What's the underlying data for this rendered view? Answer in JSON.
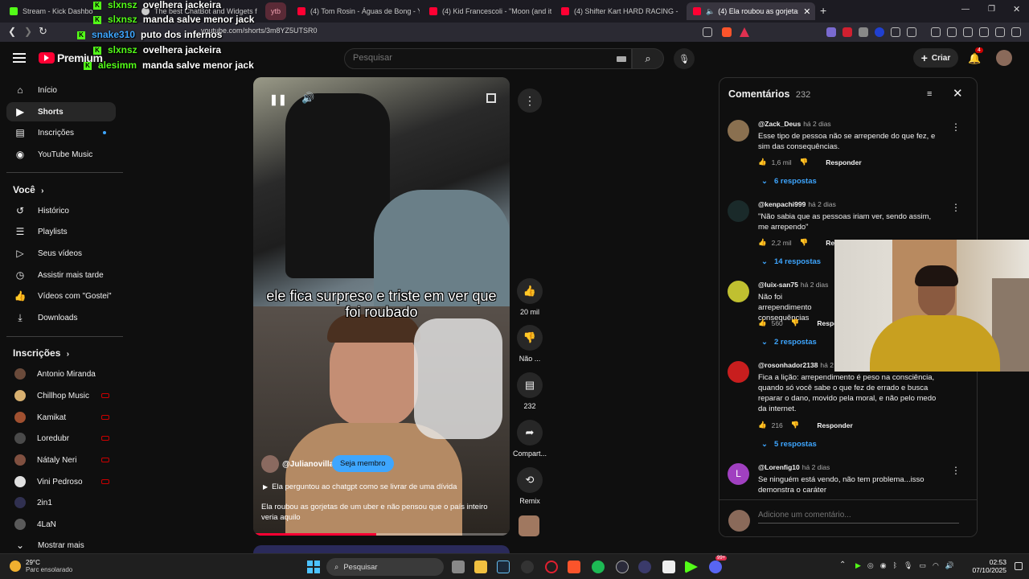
{
  "browser": {
    "tabs": [
      {
        "label": "Stream - Kick Dashboard",
        "color": "#53fc18"
      },
      {
        "label": "The best ChatBot and Widgets for Ki",
        "color": "#cccccc"
      },
      {
        "label": "ytb",
        "color": "#f0a0b0"
      },
      {
        "label": "(4) Tom Rosin - Águas de Bong - You",
        "color": "#ff0033"
      },
      {
        "label": "(4) Kid Francescoli - \"Moon (and it w",
        "color": "#ff0033"
      },
      {
        "label": "(4) Shifter Kart HARD RACING - POV",
        "color": "#ff0033"
      },
      {
        "label": "(4) Ela roubou as gorjetas de",
        "color": "#ff0033"
      }
    ],
    "new_tab": "+",
    "url": "youtube.com/shorts/3m8YZ5UTSR0"
  },
  "chat": [
    {
      "user": "slxnsz",
      "msg": "ovelhera jackeira",
      "blue": false
    },
    {
      "user": "slxnsz",
      "msg": "manda salve menor jack",
      "blue": false
    },
    {
      "user": "snake310",
      "msg": "puto dos infernos",
      "blue": true
    },
    {
      "user": "slxnsz",
      "msg": "ovelhera jackeira",
      "blue": false
    },
    {
      "user": "alesimm",
      "msg": "manda salve menor jack",
      "blue": false
    }
  ],
  "header": {
    "logo": "Premium",
    "search_placeholder": "Pesquisar",
    "create_label": "Criar",
    "notif_count": "4"
  },
  "sidebar": {
    "main": [
      {
        "label": "Início",
        "icon": "home-icon"
      },
      {
        "label": "Shorts",
        "icon": "shorts-icon"
      },
      {
        "label": "Inscrições",
        "icon": "subscriptions-icon"
      },
      {
        "label": "YouTube Music",
        "icon": "music-icon"
      }
    ],
    "voce_title": "Você",
    "voce": [
      {
        "label": "Histórico",
        "icon": "history-icon"
      },
      {
        "label": "Playlists",
        "icon": "playlist-icon"
      },
      {
        "label": "Seus vídeos",
        "icon": "video-icon"
      },
      {
        "label": "Assistir mais tarde",
        "icon": "clock-icon"
      },
      {
        "label": "Vídeos com \"Gostei\"",
        "icon": "like-icon"
      },
      {
        "label": "Downloads",
        "icon": "download-icon"
      }
    ],
    "subs_title": "Inscrições",
    "subs": [
      {
        "label": "Antonio Miranda",
        "color": "#6a4a3a",
        "live": false
      },
      {
        "label": "Chillhop Music",
        "color": "#d8b070",
        "live": true
      },
      {
        "label": "Kamikat",
        "color": "#a05030",
        "live": true
      },
      {
        "label": "Loredubr",
        "color": "#4a4a4a",
        "live": true
      },
      {
        "label": "Nátaly Neri",
        "color": "#805040",
        "live": true
      },
      {
        "label": "Vini Pedroso",
        "color": "#e0e0e0",
        "live": true
      },
      {
        "label": "2in1",
        "color": "#303050",
        "live": false
      },
      {
        "label": "4LaN",
        "color": "#5a5a5a",
        "live": false
      }
    ],
    "show_more": "Mostrar mais"
  },
  "video": {
    "caption": "ele fica surpreso e triste em ver que foi roubado",
    "channel": "@Julianovilla",
    "join_label": "Seja membro",
    "audio_line": "Ela perguntou ao chatgpt como se livrar de uma dívida",
    "title": "Ela roubou as gorjetas de um uber e não pensou que o país inteiro veria aquilo",
    "progress": 0.48
  },
  "actions": {
    "likes": "20 mil",
    "dislike": "Não ...",
    "comments": "232",
    "share": "Compart...",
    "remix": "Remix"
  },
  "comments": {
    "title": "Comentários",
    "count": "232",
    "reply_label": "Responder",
    "add_placeholder": "Adicione um comentário...",
    "items": [
      {
        "author": "@Zack_Deus",
        "ago": "há 2 dias",
        "text": "Esse tipo de pessoa não se arrepende do que fez, e sim das consequências.",
        "likes": "1,6 mil",
        "replies": "6 respostas",
        "avatar": "#8a7050"
      },
      {
        "author": "@kenpachi999",
        "ago": "há 2 dias",
        "text": "\"Não sabia que as pessoas iriam ver, sendo assim, me arrependo\"",
        "likes": "2,2 mil",
        "replies": "14 respostas",
        "avatar": "#1a2a2a"
      },
      {
        "author": "@luix-san75",
        "ago": "há 2 dias",
        "text": "Não foi arrependimento consequências",
        "likes": "560",
        "replies": "2 respostas",
        "avatar": "#c0c030"
      },
      {
        "author": "@rosonhador2138",
        "ago": "há 2",
        "text": "Fica a lição: arrependimento é peso na consciência, quando só você sabe o que fez de errado e busca reparar o dano, movido pela moral, e não pelo medo da internet.",
        "likes": "216",
        "replies": "5 respostas",
        "avatar": "#c81e1e"
      },
      {
        "author": "@Lorenfig10",
        "ago": "há 2 dias",
        "text": "Se ninguém está vendo, não tem problema...isso demonstra o caráter",
        "likes": "",
        "replies": "",
        "avatar": "#a040c0",
        "letter": "L"
      }
    ]
  },
  "taskbar": {
    "weather_temp": "29°C",
    "weather_desc": "Parc ensolarado",
    "search": "Pesquisar",
    "time": "02:53",
    "date": "07/10/2025",
    "discord_badge": "99+"
  }
}
